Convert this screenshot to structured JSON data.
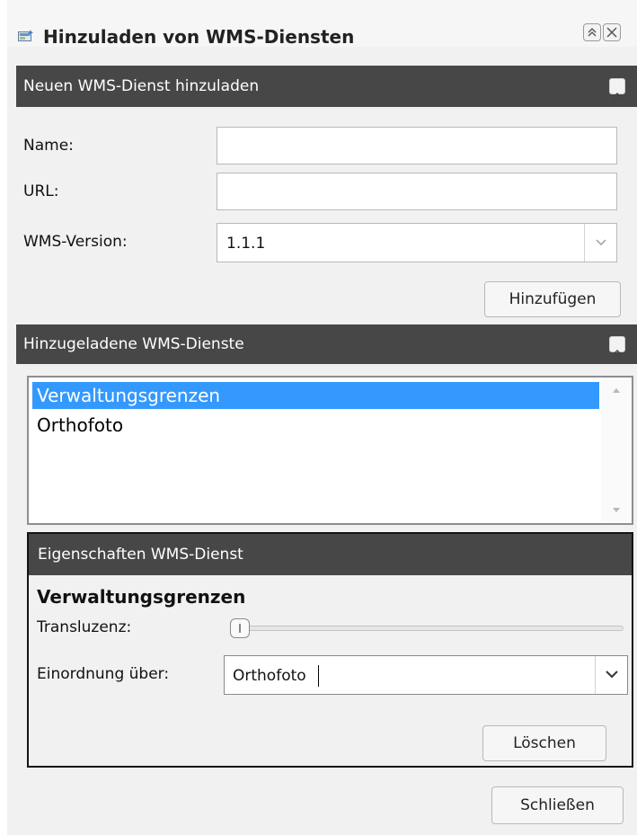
{
  "window": {
    "title": "Hinzuladen von WMS-Diensten",
    "icon": "wms-add-icon",
    "buttons": [
      "collapse-icon",
      "close-icon"
    ]
  },
  "new_service": {
    "header": "Neuen WMS-Dienst hinzuladen",
    "name_label": "Name:",
    "name_value": "",
    "url_label": "URL:",
    "url_value": "",
    "version_label": "WMS-Version:",
    "version_value": "1.1.1",
    "add_button": "Hinzufügen"
  },
  "loaded_services": {
    "header": "Hinzugeladene WMS-Dienste",
    "items": [
      "Verwaltungsgrenzen",
      "Orthofoto"
    ],
    "selected_index": 0
  },
  "properties": {
    "header": "Eigenschaften WMS-Dienst",
    "service_name": "Verwaltungsgrenzen",
    "translucency_label": "Transluzenz:",
    "translucency_value": 0,
    "order_label": "Einordnung über:",
    "order_value": "Orthofoto",
    "delete_button": "Löschen"
  },
  "close_button": "Schließen",
  "colors": {
    "header_bg": "#474747",
    "selection": "#3399ff",
    "panel_bg": "#f1f1f1"
  }
}
